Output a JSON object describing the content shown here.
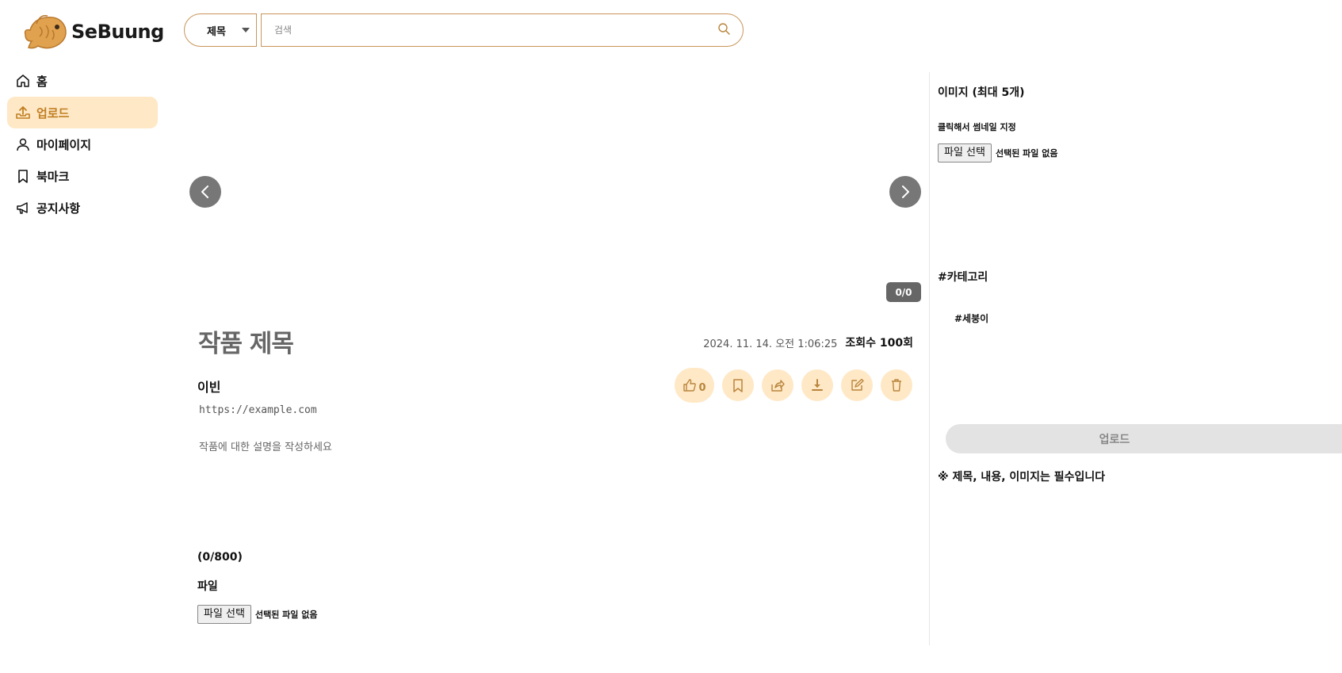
{
  "brand": {
    "name": "SeBuung",
    "accent": "#c07f22",
    "accent_bg": "#ffe8c6"
  },
  "search": {
    "type_label": "제목",
    "placeholder": "검색"
  },
  "sidebar": {
    "items": [
      {
        "label": "홈",
        "icon": "home-icon"
      },
      {
        "label": "업로드",
        "icon": "upload-icon",
        "active": true
      },
      {
        "label": "마이페이지",
        "icon": "user-icon"
      },
      {
        "label": "북마크",
        "icon": "bookmark-icon"
      },
      {
        "label": "공지사항",
        "icon": "megaphone-icon"
      }
    ]
  },
  "carousel": {
    "counter": "0/0"
  },
  "post": {
    "title": "작품 제목",
    "date": "2024. 11. 14. 오전 1:06:25",
    "views": "조회수 100회",
    "author": "이빈",
    "link": "https://example.com",
    "description": "작품에 대한 설명을 작성하세요",
    "like_count": "0",
    "char_count": "(0/800)",
    "file_label": "파일",
    "file_button": "파일 선택",
    "file_status": "선택된 파일 없음"
  },
  "right_panel": {
    "images_title": "이미지 (최대 5개)",
    "thumbnail_hint": "클릭해서 썸네일 지정",
    "file_button": "파일 선택",
    "file_status": "선택된 파일 없음",
    "category_title": "#카테고리",
    "category_item": "#세붕이",
    "upload_button": "업로드",
    "notice": "※ 제목, 내용, 이미지는 필수입니다"
  }
}
